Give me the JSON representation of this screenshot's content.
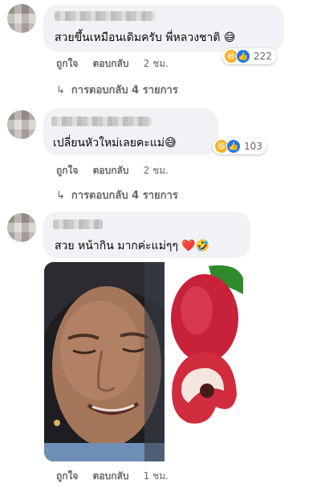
{
  "comments": [
    {
      "text": "สวยขึ้นเหมือนเดิมครับ พี่หลวงชาติ 😅",
      "reaction_count": "222",
      "actions": {
        "like": "ถูกใจ",
        "reply": "ตอบกลับ",
        "time": "2 ชม."
      },
      "replies_label": "การตอบกลับ 4 รายการ"
    },
    {
      "text": "เปลี่ยนหัวใหม่เลยคะแม่😅",
      "reaction_count": "103",
      "actions": {
        "like": "ถูกใจ",
        "reply": "ตอบกลับ",
        "time": "2 ชม."
      },
      "replies_label": "การตอบกลับ 4 รายการ"
    },
    {
      "text": "สวย หน้ากิน มากค่ะแม่ๆๆ ❤️🤣",
      "actions": {
        "like": "ถูกใจ",
        "reply": "ตอบกลับ",
        "time": "1 ชม."
      }
    }
  ],
  "colors": {
    "bubble": "#f0f2f5",
    "meta": "#65676b",
    "like_blue": "#1877f2",
    "haha_yellow": "#f7b125"
  },
  "icons": {
    "reply_arrow": "reply-arrow-icon",
    "haha": "haha-reaction-icon",
    "like": "like-reaction-icon"
  }
}
